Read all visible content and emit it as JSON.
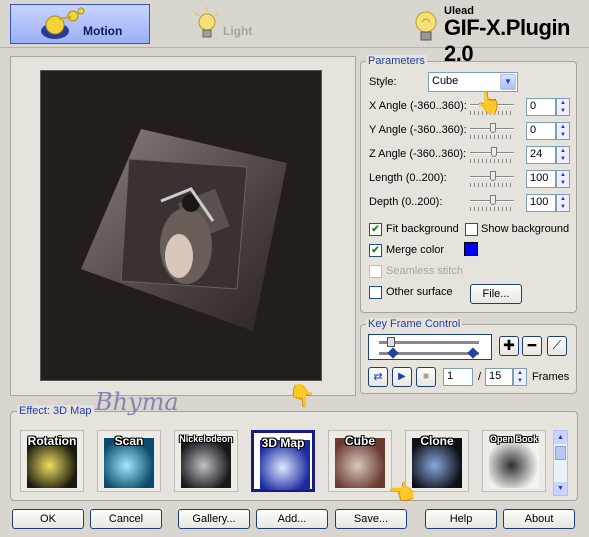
{
  "header": {
    "tabs": [
      {
        "label": "Motion",
        "active": true,
        "icon": "bulbs-icon"
      },
      {
        "label": "Light",
        "active": false,
        "icon": "lightbulb-icon"
      }
    ],
    "brand_small": "Ulead",
    "brand_big": "GIF-X.Plugin 2.0"
  },
  "parameters": {
    "title": "Parameters",
    "style_label": "Style:",
    "style_value": "Cube",
    "angles": [
      {
        "label": "X Angle (-360..360):",
        "value": "0"
      },
      {
        "label": "Y Angle (-360..360):",
        "value": "0"
      },
      {
        "label": "Z Angle (-360..360):",
        "value": "24"
      },
      {
        "label": "Length (0..200):",
        "value": "100"
      },
      {
        "label": "Depth (0..200):",
        "value": "100"
      }
    ],
    "fit_background": {
      "label": "Fit background",
      "checked": true
    },
    "show_background": {
      "label": "Show background",
      "checked": false
    },
    "merge_color": {
      "label": "Merge color",
      "checked": true,
      "color": "#0000ff"
    },
    "seamless_stitch": {
      "label": "Seamless stitch",
      "checked": false,
      "disabled": true
    },
    "other_surface": {
      "label": "Other surface",
      "checked": false
    },
    "file_button": "File..."
  },
  "keyframe": {
    "title": "Key Frame Control",
    "current_frame": "1",
    "separator": "/",
    "total_frames": "15",
    "frames_label": "Frames"
  },
  "effect": {
    "title": "Effect: 3D Map",
    "watermark": "Bhyma",
    "items": [
      {
        "label": "Rotation",
        "selected": false
      },
      {
        "label": "Scan",
        "selected": false
      },
      {
        "label": "Nickelodeon",
        "selected": false
      },
      {
        "label": "3D Map",
        "selected": true
      },
      {
        "label": "Cube",
        "selected": false
      },
      {
        "label": "Clone",
        "selected": false
      },
      {
        "label": "Open Book",
        "selected": false
      }
    ]
  },
  "buttons": {
    "ok": "OK",
    "cancel": "Cancel",
    "gallery": "Gallery...",
    "add": "Add...",
    "save": "Save...",
    "help": "Help",
    "about": "About"
  },
  "colors": {
    "accent": "#2240a8",
    "preview_bg": "#231e1c",
    "merge_color": "#0000ff"
  }
}
